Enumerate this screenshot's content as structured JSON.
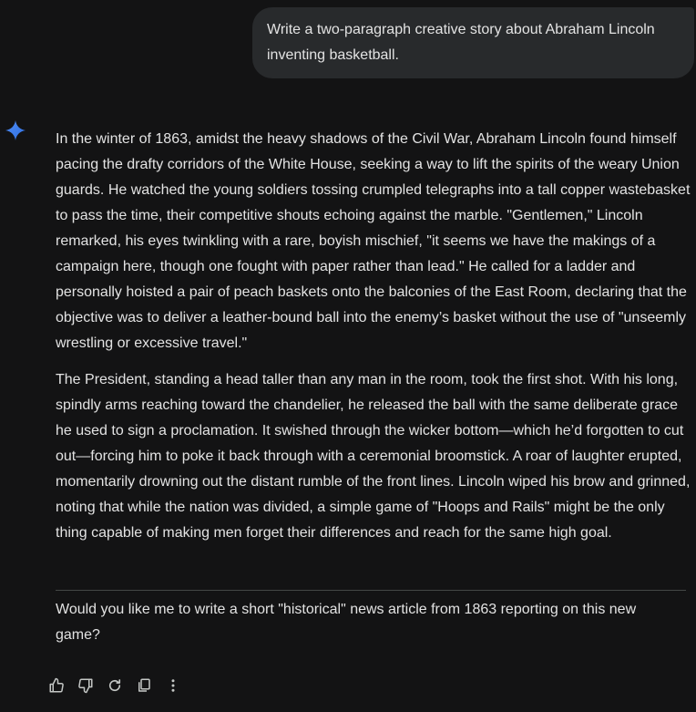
{
  "user_prompt": "Write a two-paragraph creative story about Abraham Lincoln inventing basketball.",
  "response": {
    "paragraphs": [
      "In the winter of 1863, amidst the heavy shadows of the Civil War, Abraham Lincoln found himself pacing the drafty corridors of the White House, seeking a way to lift the spirits of the weary Union guards. He watched the young soldiers tossing crumpled telegraphs into a tall copper wastebasket to pass the time, their competitive shouts echoing against the marble. \"Gentlemen,\" Lincoln remarked, his eyes twinkling with a rare, boyish mischief, \"it seems we have the makings of a campaign here, though one fought with paper rather than lead.\" He called for a ladder and personally hoisted a pair of peach baskets onto the balconies of the East Room, declaring that the objective was to deliver a leather-bound ball into the enemy’s basket without the use of \"unseemly wrestling or excessive travel.\"",
      "The President, standing a head taller than any man in the room, took the first shot. With his long, spindly arms reaching toward the chandelier, he released the ball with the same deliberate grace he used to sign a proclamation. It swished through the wicker bottom—which he’d forgotten to cut out—forcing him to poke it back through with a ceremonial broomstick. A roar of laughter erupted, momentarily drowning out the distant rumble of the front lines. Lincoln wiped his brow and grinned, noting that while the nation was divided, a simple game of \"Hoops and Rails\" might be the only thing capable of making men forget their differences and reach for the same high goal."
    ],
    "followup": "Would you like me to write a short \"historical\" news article from 1863 reporting on this new game?"
  },
  "actions": [
    "thumbs-up-icon",
    "thumbs-down-icon",
    "redo-icon",
    "copy-icon",
    "more-vert-icon"
  ],
  "colors": {
    "background": "#131314",
    "bubble": "#282a2c",
    "text": "#e3e3e3",
    "accent": "#4285f4"
  }
}
